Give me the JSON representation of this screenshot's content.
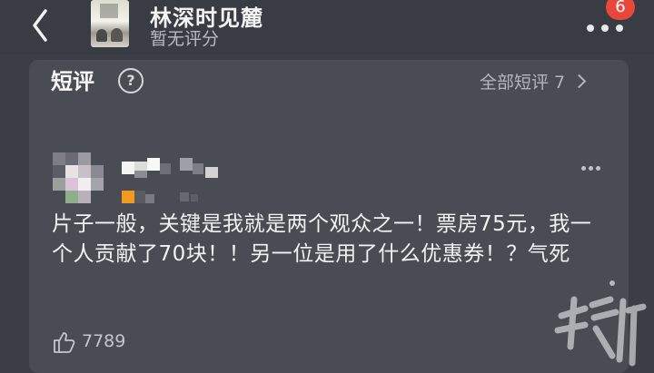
{
  "header": {
    "title": "林深时见麓",
    "rating_text": "暂无评分",
    "notification_count": "6"
  },
  "section": {
    "title": "短评",
    "help_symbol": "?",
    "all_link_label": "全部短评 7"
  },
  "comment": {
    "text": "片子一般，关键是我就是两个观众之一！票房75元，我一个人贡献了70块！！另一位是用了什么优惠券！？气死",
    "like_count": "7789"
  },
  "icons": [
    "back-arrow-icon",
    "more-icon",
    "help-icon",
    "chevron-right-icon",
    "thumbs-up-icon"
  ],
  "colors": {
    "background": "#3c3e45",
    "card": "#4a4c53",
    "badge": "#e8473c",
    "level_badge": "#f29a1f"
  }
}
